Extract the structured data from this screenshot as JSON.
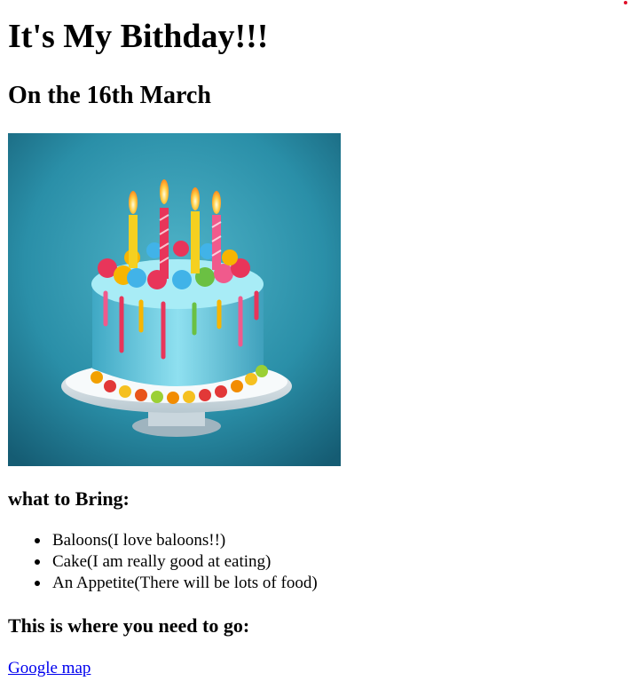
{
  "page": {
    "heading": "It's My Bithday!!!",
    "subheading": "On the 16th March"
  },
  "image": {
    "alt": "Birthday cake with four candles",
    "icon": "birthday-cake-image"
  },
  "bring": {
    "heading": "what to Bring:",
    "items": [
      "Baloons(I love baloons!!)",
      "Cake(I am really good at eating)",
      "An Appetite(There will be lots of food)"
    ]
  },
  "location": {
    "heading": "This is where you need to go:",
    "link_text": "Google map"
  },
  "colors": {
    "link": "#0000ee",
    "corner_dot": "#e0102a",
    "image_background": "#2a8fa8",
    "frosting": "#5ec8e0"
  }
}
